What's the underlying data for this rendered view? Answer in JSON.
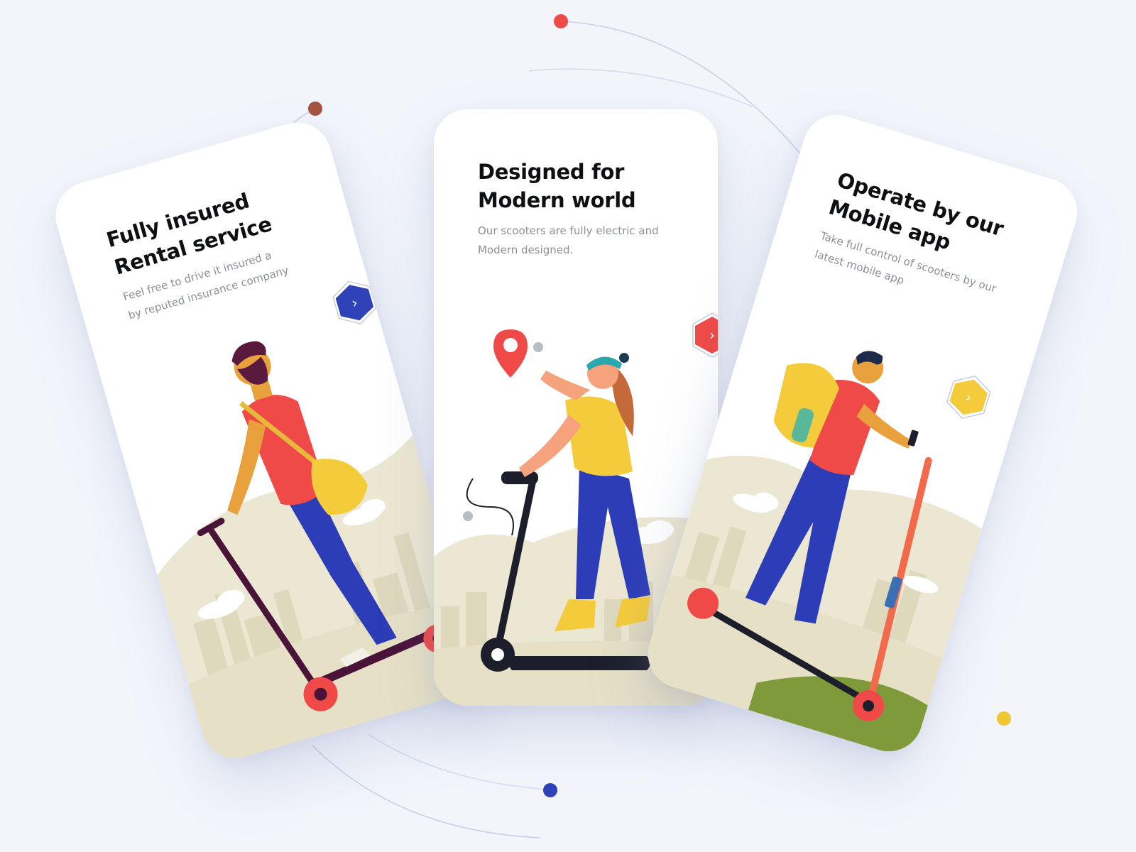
{
  "colors": {
    "background": "#f3f5fb",
    "card": "#ffffff",
    "title": "#0f1014",
    "desc": "#8b8f99",
    "accent_blue": "#2f42b8",
    "accent_red": "#ef4a47",
    "accent_yellow": "#f4cb3b",
    "dot_brown": "#a3543f",
    "dot_red": "#ef4a47",
    "dot_blue": "#2f42b8",
    "dot_yellow": "#f1c633",
    "ground": "#e9e4cc"
  },
  "screens": [
    {
      "title_lines": [
        "Fully insured",
        "Rental service"
      ],
      "desc_lines": [
        "Feel free to drive it insured a",
        "by reputed insurance company"
      ],
      "next_icon": "chevron-right-icon",
      "next_color": "#2f42b8"
    },
    {
      "title_lines": [
        "Designed for",
        "Modern world"
      ],
      "desc_lines": [
        "Our scooters are fully electric and",
        "Modern designed."
      ],
      "next_icon": "chevron-right-icon",
      "next_color": "#ef4a47"
    },
    {
      "title_lines": [
        "Operate by our",
        "Mobile app"
      ],
      "desc_lines": [
        "Take full control of scooters by our",
        "latest mobile app"
      ],
      "next_icon": "chevron-right-icon",
      "next_color": "#f4cb3b"
    }
  ],
  "icons": {
    "chevron": "›",
    "location_pin": "location-pin-icon",
    "phone": "phone-icon"
  }
}
